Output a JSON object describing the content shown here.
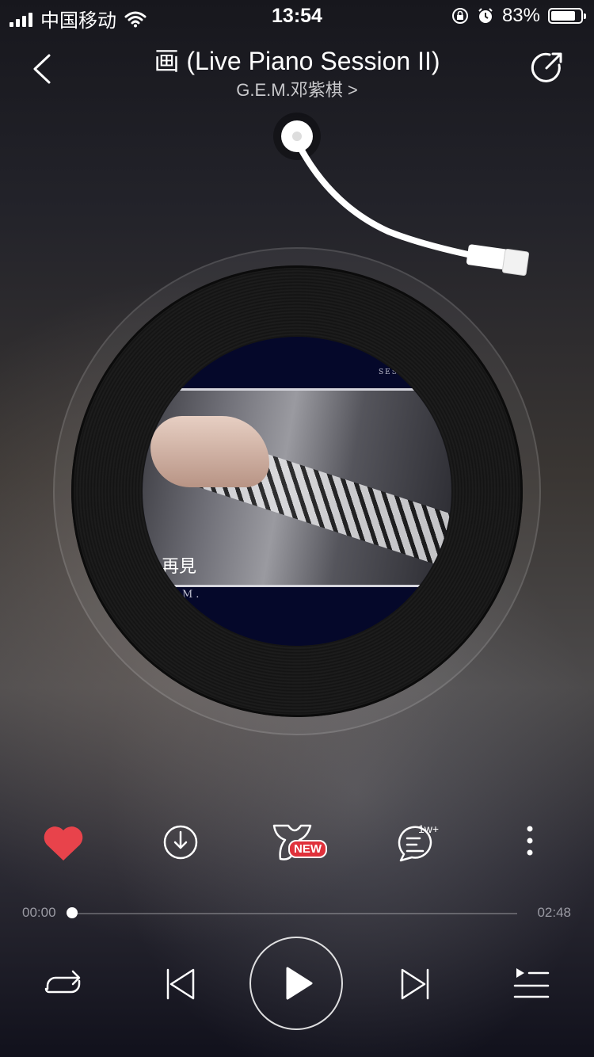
{
  "status_bar": {
    "carrier": "中国移动",
    "time": "13:54",
    "battery_percent": "83%",
    "battery_level": 0.83,
    "icons": [
      "signal-icon",
      "wifi-icon",
      "orientation-lock-icon",
      "alarm-icon",
      "battery-icon"
    ]
  },
  "header": {
    "title": "画 (Live Piano Session II)",
    "artist": "G.E.M.邓紫棋 >"
  },
  "cover": {
    "top_small_text": "SES",
    "caption": "再見",
    "bottom_text": "M."
  },
  "actions": {
    "new_badge": "NEW",
    "comment_count": "1w+",
    "like_color": "#e8434b"
  },
  "progress": {
    "current": "00:00",
    "total": "02:48",
    "fraction": 0
  },
  "colors": {
    "accent_red": "#e0313b"
  }
}
